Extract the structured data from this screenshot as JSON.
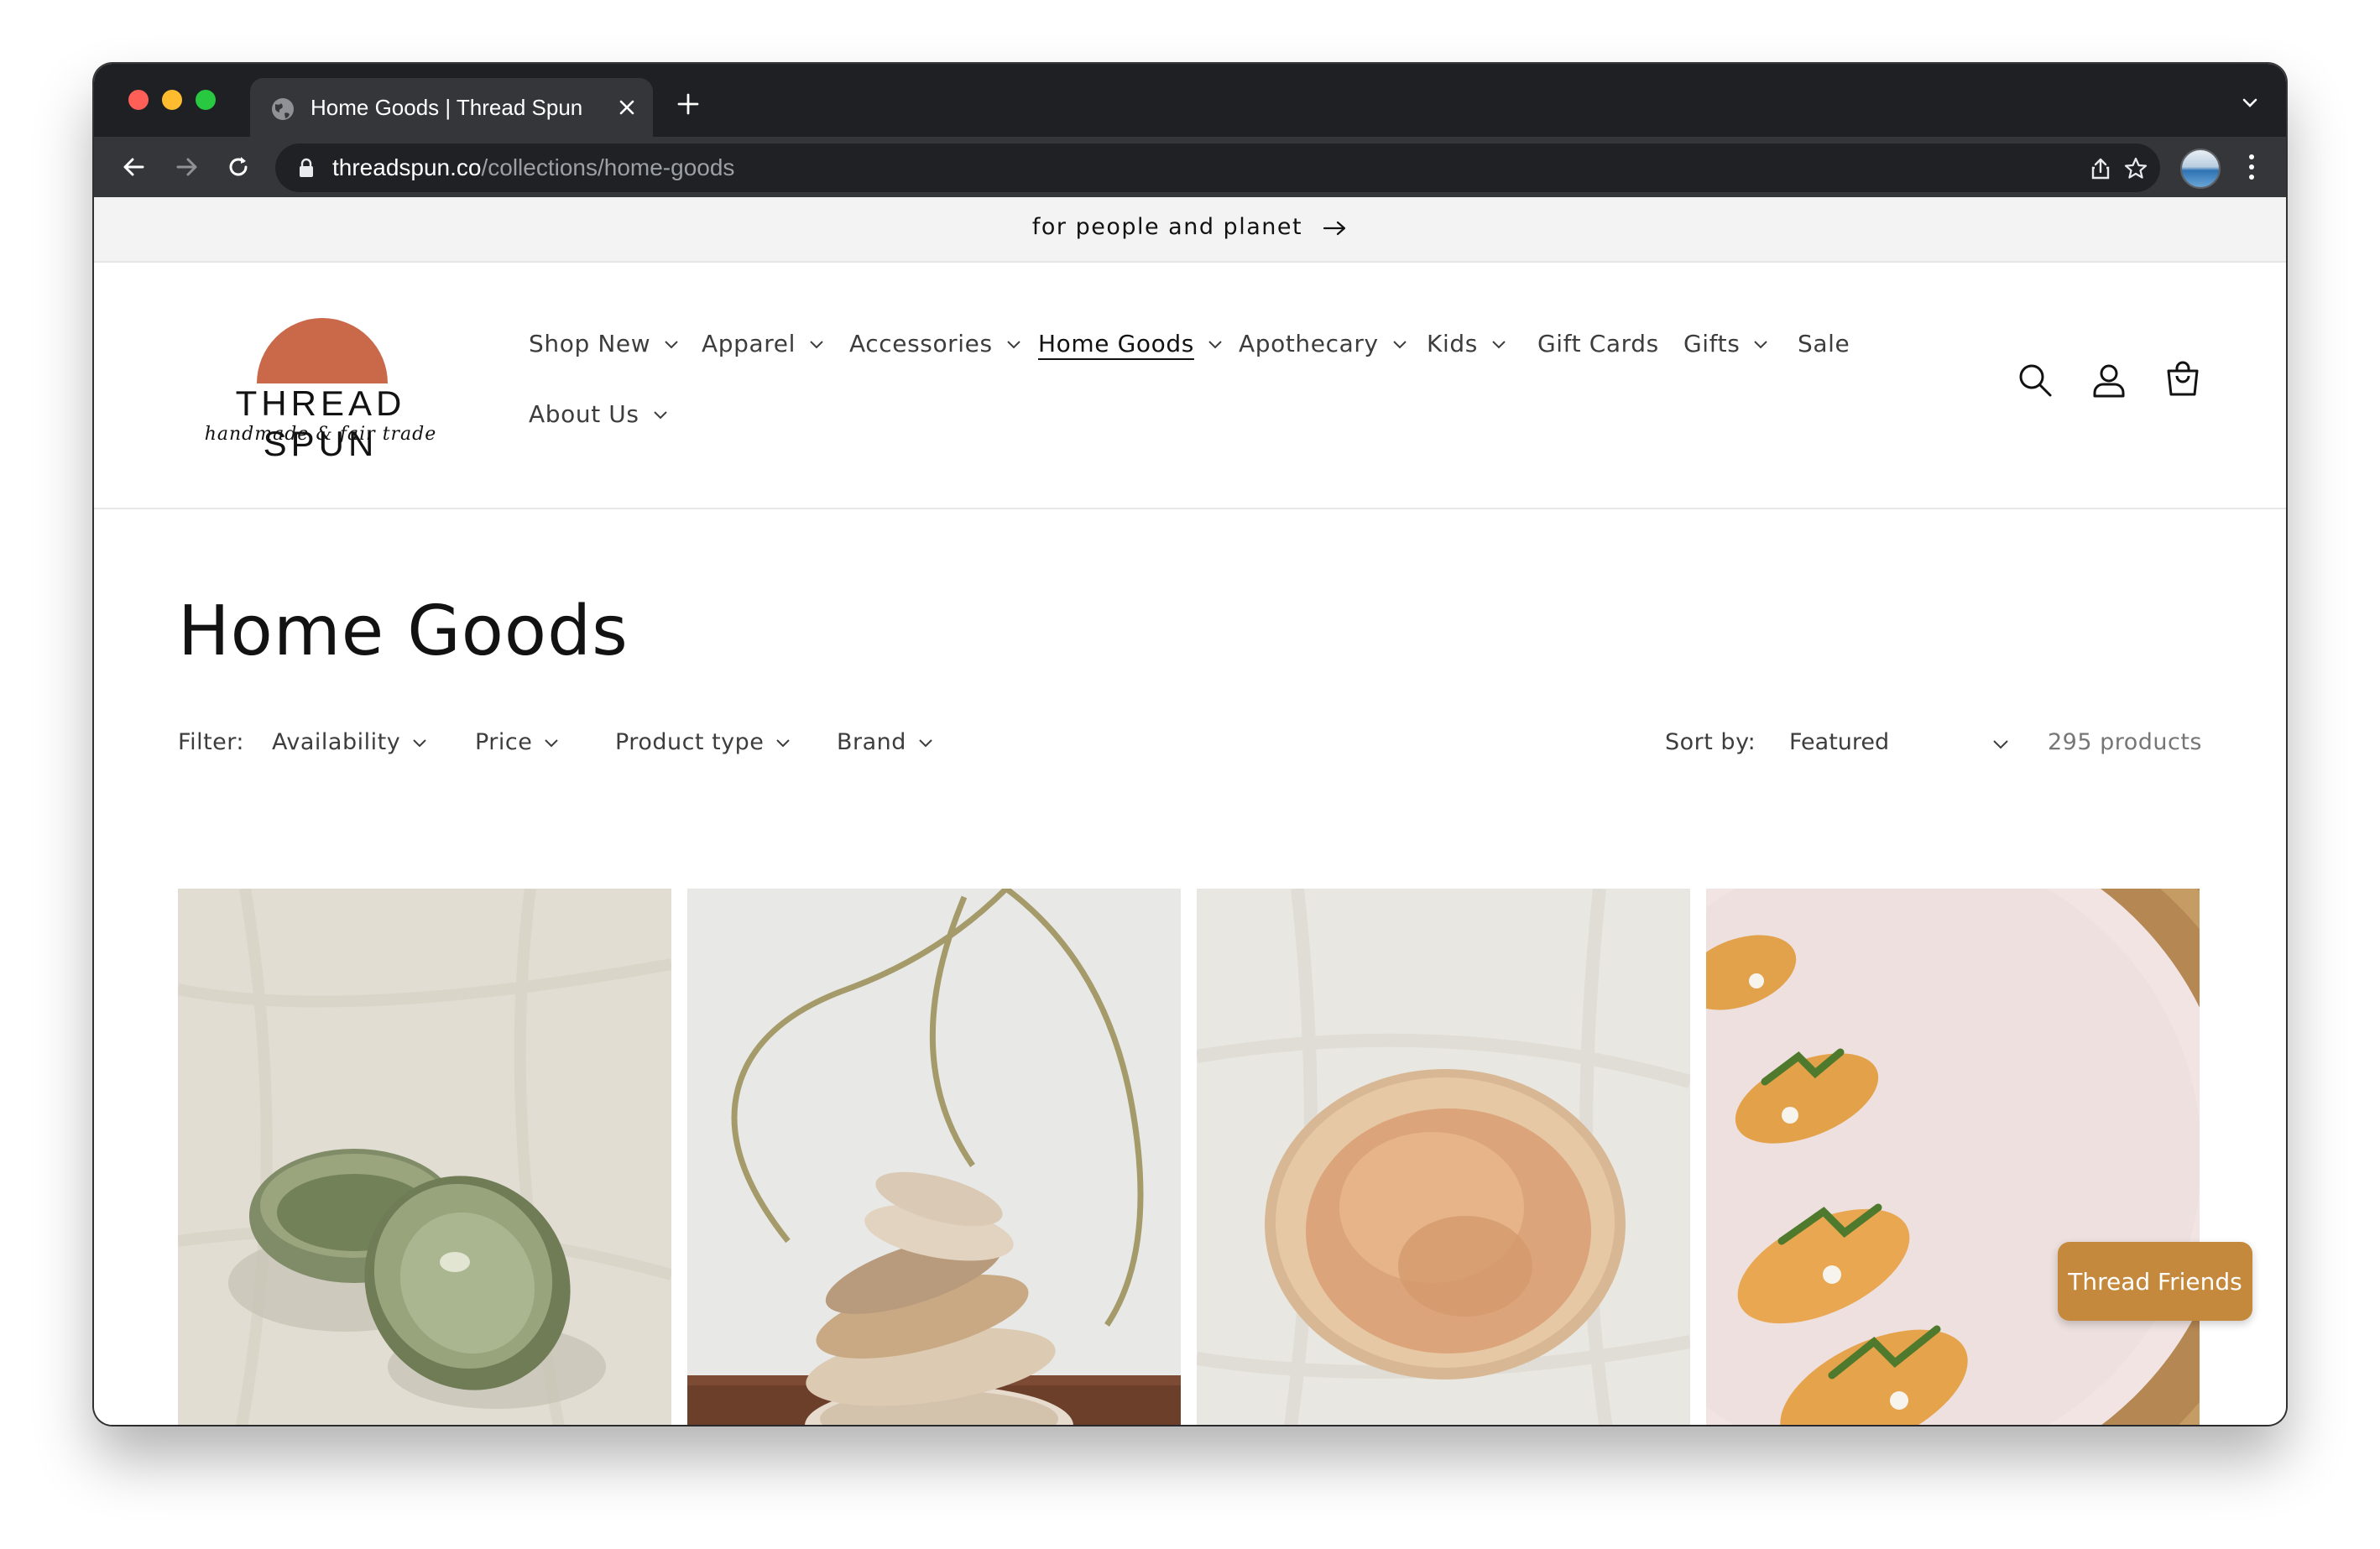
{
  "browser": {
    "tab_title": "Home Goods | Thread Spun",
    "url_host": "threadspun.co",
    "url_path": "/collections/home-goods"
  },
  "announcement": {
    "text": "for people and planet"
  },
  "logo": {
    "wordmark": "THREAD SPUN",
    "tagline": "handmade & fair trade",
    "sun_color": "#c9694a"
  },
  "nav": {
    "items": [
      {
        "label": "Shop New"
      },
      {
        "label": "Apparel"
      },
      {
        "label": "Accessories"
      },
      {
        "label": "Home Goods"
      },
      {
        "label": "Apothecary"
      },
      {
        "label": "Kids"
      },
      {
        "label": "Gift Cards"
      },
      {
        "label": "Gifts"
      },
      {
        "label": "Sale"
      },
      {
        "label": "About Us"
      }
    ],
    "active": "Home Goods"
  },
  "collection": {
    "title": "Home Goods",
    "filter_label": "Filter:",
    "filters": [
      "Availability",
      "Price",
      "Product type",
      "Brand"
    ],
    "sort_label": "Sort by:",
    "sort_value": "Featured",
    "product_count": "295 products"
  },
  "products": [
    {
      "image": "green-glazed-ceramic-bowls"
    },
    {
      "image": "stacked-ceramic-dishes"
    },
    {
      "image": "peach-ceramic-bowl"
    },
    {
      "image": "platter-with-crostini"
    }
  ],
  "widget": {
    "label": "Thread Friends",
    "color": "#c4893c"
  }
}
